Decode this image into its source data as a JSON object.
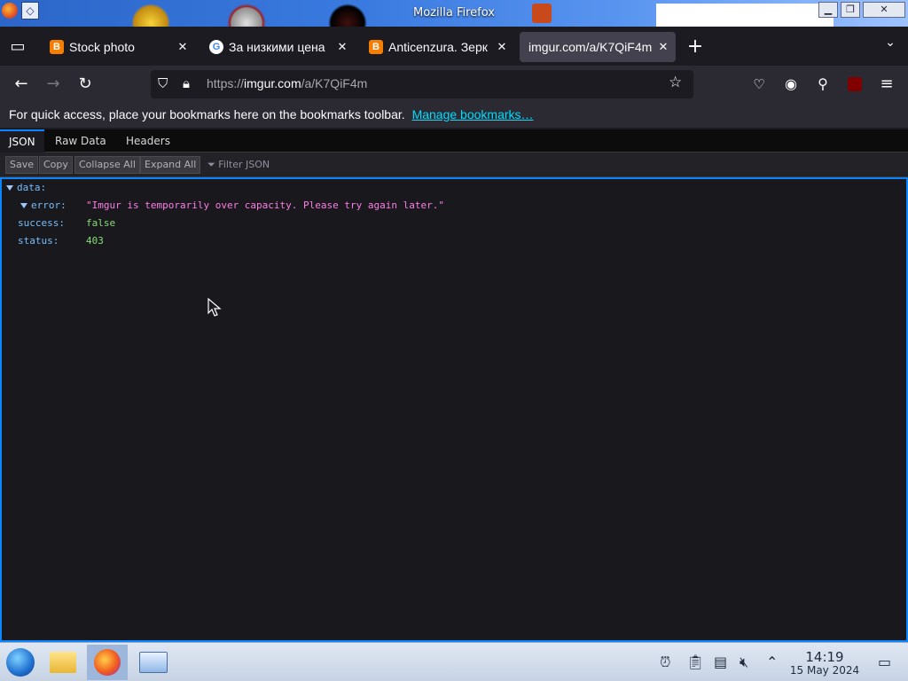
{
  "window": {
    "title": "Mozilla Firefox",
    "buttons": {
      "minimize": "▁",
      "maximize": "❐",
      "close": "✕"
    }
  },
  "tabs": [
    {
      "label": "Stock photo",
      "favicon": "blogger-icon",
      "active": false
    },
    {
      "label": "За низкими цена",
      "favicon": "google-icon",
      "active": false
    },
    {
      "label": "Anticenzura. Зерк",
      "favicon": "blogger-icon",
      "active": false
    },
    {
      "label": "imgur.com/a/K7QiF4m",
      "favicon": "none",
      "active": true
    }
  ],
  "tab_close": "✕",
  "new_tab": "+",
  "toolbar": {
    "url_prefix": "https://",
    "url_host": "imgur.com",
    "url_path": "/a/K7QiF4m"
  },
  "bookmarks_bar": {
    "message": "For quick access, place your bookmarks here on the bookmarks toolbar.",
    "link": "Manage bookmarks…"
  },
  "json_viewer": {
    "tabs": [
      "JSON",
      "Raw Data",
      "Headers"
    ],
    "buttons": [
      "Save",
      "Copy",
      "Collapse All",
      "Expand All"
    ],
    "filter_placeholder": "Filter JSON",
    "rows": {
      "data_key": "data:",
      "error_key": "error:",
      "error_value": "\"Imgur is temporarily over capacity. Please try again later.\"",
      "success_key": "success:",
      "success_value": "false",
      "status_key": "status:",
      "status_value": "403"
    }
  },
  "taskbar": {
    "time": "14:19",
    "date": "15 May 2024"
  },
  "colors": {
    "accent": "#0a84ff",
    "json_key": "#75bfff",
    "json_string": "#ff7de9",
    "json_literal": "#86de74"
  }
}
